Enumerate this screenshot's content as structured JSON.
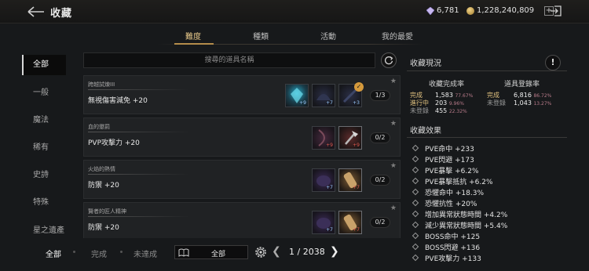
{
  "header": {
    "title": "收藏",
    "currency_gem": "6,781",
    "currency_gold": "1,228,240,809",
    "plus": "+"
  },
  "tabs": [
    {
      "label": "難度",
      "active": true
    },
    {
      "label": "種類",
      "active": false
    },
    {
      "label": "活動",
      "active": false
    },
    {
      "label": "我的最愛",
      "active": false
    }
  ],
  "sidebar": [
    {
      "label": "全部",
      "active": true
    },
    {
      "label": "一般"
    },
    {
      "label": "魔法"
    },
    {
      "label": "稀有"
    },
    {
      "label": "史詩"
    },
    {
      "label": "特殊"
    },
    {
      "label": "星之遺產"
    }
  ],
  "search": {
    "placeholder": "搜尋的道具名稱"
  },
  "items": [
    {
      "category": "跨越試煉III",
      "effect": "無視傷害減免 +20",
      "progress": "1/3",
      "slots": [
        {
          "count": "+9",
          "style": "filled-blue",
          "count_color": "blue"
        },
        {
          "count": "+7",
          "style": "filled-dark",
          "count_color": "blue"
        },
        {
          "count": "+3",
          "style": "filled-dark",
          "count_color": "blue",
          "checked": true
        }
      ]
    },
    {
      "category": "血的懲罰",
      "effect": "PVP攻擊力 +20",
      "progress": "0/2",
      "slots": [
        {
          "count": "+9",
          "style": "filled-purple",
          "count_color": "red"
        },
        {
          "count": "+9",
          "style": "filled-red",
          "count_color": "red"
        }
      ]
    },
    {
      "category": "火焰的熱情",
      "effect": "防禦 +20",
      "progress": "0/2",
      "slots": [
        {
          "count": "+7",
          "style": "filled-violet",
          "count_color": "blue"
        },
        {
          "count": "+7",
          "style": "filled-gold",
          "count_color": "red"
        }
      ]
    },
    {
      "category": "賢者的匠人精神",
      "effect": "防禦 +20",
      "progress": "0/2",
      "slots": [
        {
          "count": "+7",
          "style": "filled-violet",
          "count_color": "blue"
        },
        {
          "count": "+7",
          "style": "filled-gold",
          "count_color": "red"
        }
      ]
    }
  ],
  "status": {
    "title": "收藏現況",
    "info": "!",
    "completion_head": "收藏完成率",
    "registration_head": "道具登錄率",
    "completion": [
      {
        "k": "完成",
        "v": "1,583",
        "p": "77.67%"
      },
      {
        "k": "進行中",
        "v": "203",
        "p": "9.96%"
      },
      {
        "k": "未登錄",
        "v": "455",
        "p": "22.32%"
      }
    ],
    "registration": [
      {
        "k": "完成",
        "v": "6,816",
        "p": "86.72%"
      },
      {
        "k": "未登錄",
        "v": "1,043",
        "p": "13.27%"
      }
    ]
  },
  "effects": {
    "title": "收藏效果",
    "list": [
      "PVE命中 +233",
      "PVE閃避 +173",
      "PVE暴擊 +6.2%",
      "PVE暴擊抵抗 +6.2%",
      "恐懼命中 +18.3%",
      "恐懼抗性 +20%",
      "增加異常狀態時間 +4.2%",
      "減少異常狀態時間 +5.4%",
      "BOSS命中 +125",
      "BOSS閃避 +136",
      "PVE攻擊力 +133"
    ]
  },
  "bottom": {
    "filters": [
      {
        "label": "全部",
        "active": true
      },
      {
        "label": "完成"
      },
      {
        "label": "未達成"
      }
    ],
    "book_select": "全部",
    "pager": "1 / 2038"
  }
}
